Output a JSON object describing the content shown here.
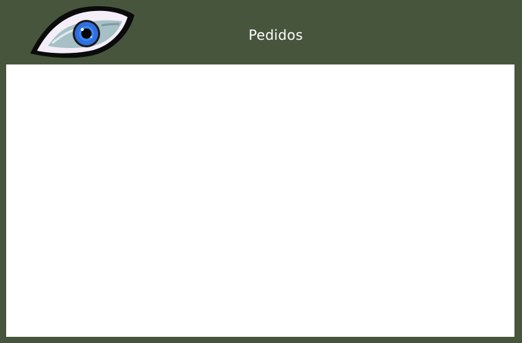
{
  "header": {
    "title": "Pedidos",
    "logo_icon": "eye-icon"
  },
  "colors": {
    "background": "#47553d",
    "panel": "#ffffff",
    "title_text": "#ffffff",
    "iris": "#2f6fe0"
  }
}
